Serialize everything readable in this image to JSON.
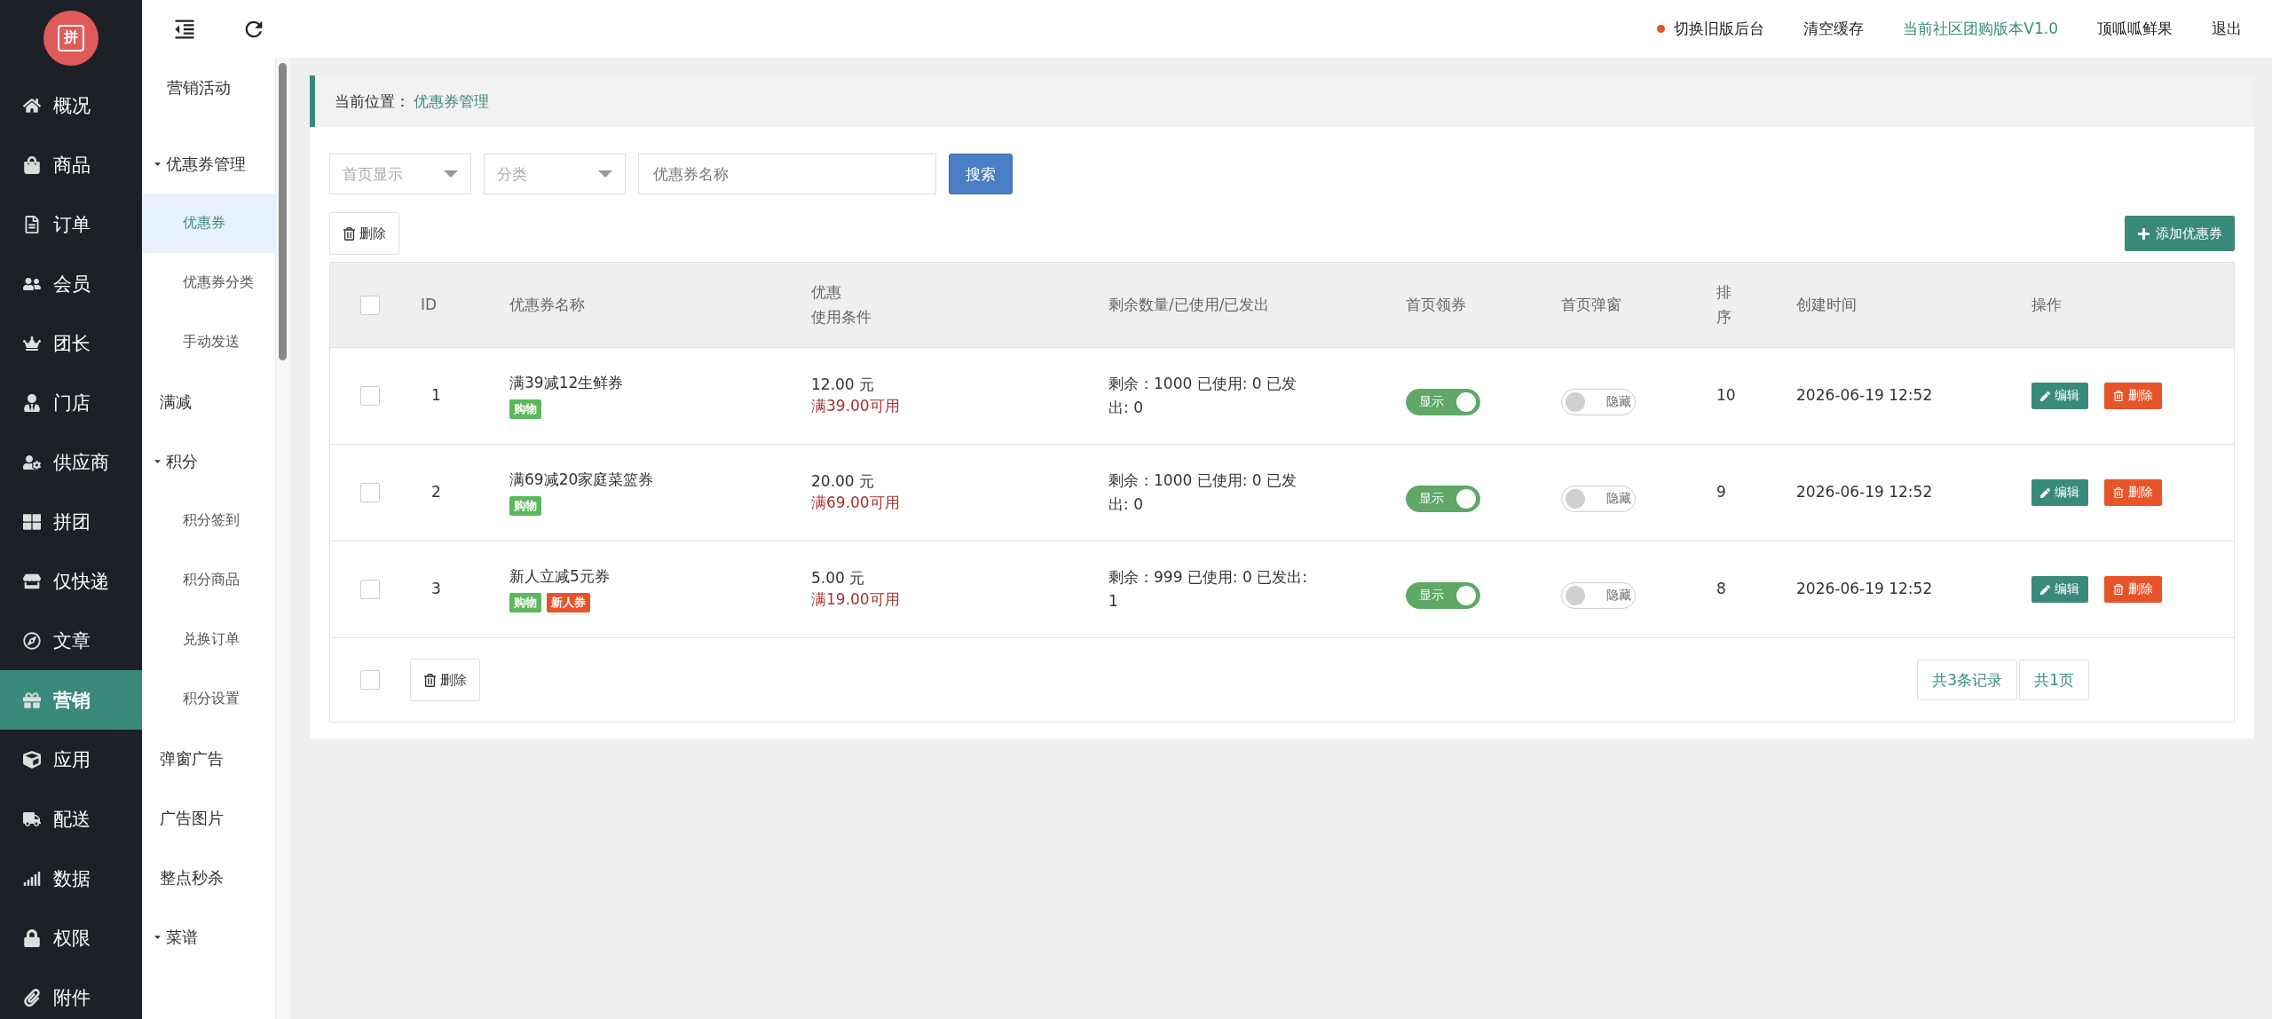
{
  "logo": {
    "text": "拼"
  },
  "nav": [
    {
      "label": "概况",
      "selected": false
    },
    {
      "label": "商品",
      "selected": false
    },
    {
      "label": "订单",
      "selected": false
    },
    {
      "label": "会员",
      "selected": false
    },
    {
      "label": "团长",
      "selected": false
    },
    {
      "label": "门店",
      "selected": false
    },
    {
      "label": "供应商",
      "selected": false
    },
    {
      "label": "拼团",
      "selected": false
    },
    {
      "label": "仅快递",
      "selected": false
    },
    {
      "label": "文章",
      "selected": false
    },
    {
      "label": "营销",
      "selected": true
    },
    {
      "label": "应用",
      "selected": false
    },
    {
      "label": "配送",
      "selected": false
    },
    {
      "label": "数据",
      "selected": false
    },
    {
      "label": "权限",
      "selected": false
    },
    {
      "label": "附件",
      "selected": false
    }
  ],
  "submenu": {
    "title": "营销活动",
    "items": [
      {
        "label": "优惠券管理",
        "expanded": true,
        "selected": false,
        "children": [
          {
            "label": "优惠券",
            "selected": true
          },
          {
            "label": "优惠券分类",
            "selected": false
          },
          {
            "label": "手动发送",
            "selected": false
          }
        ]
      },
      {
        "label": "满减",
        "selected": false
      },
      {
        "label": "积分",
        "expanded": true,
        "selected": false,
        "children": [
          {
            "label": "积分签到",
            "selected": false
          },
          {
            "label": "积分商品",
            "selected": false
          },
          {
            "label": "兑换订单",
            "selected": false
          },
          {
            "label": "积分设置",
            "selected": false
          }
        ]
      },
      {
        "label": "弹窗广告",
        "selected": false
      },
      {
        "label": "广告图片",
        "selected": false
      },
      {
        "label": "整点秒杀",
        "selected": false
      },
      {
        "label": "菜谱",
        "expanded": true,
        "selected": false
      }
    ]
  },
  "header": {
    "links": [
      {
        "label": "切换旧版后台",
        "kind": "dot"
      },
      {
        "label": "清空缓存",
        "kind": "plain"
      },
      {
        "label": "当前社区团购版本V1.0",
        "kind": "accent"
      },
      {
        "label": "顶呱呱鲜果",
        "kind": "plain"
      },
      {
        "label": "退出",
        "kind": "plain"
      }
    ]
  },
  "breadcrumb": {
    "label": "当前位置：",
    "current": "优惠券管理"
  },
  "filters": {
    "selects": [
      {
        "placeholder": "首页显示"
      },
      {
        "placeholder": "分类"
      }
    ],
    "search": {
      "placeholder": "优惠券名称"
    },
    "button": "搜索"
  },
  "toolbar": {
    "delete": "删除",
    "add": "添加优惠券"
  },
  "table": {
    "select_all": {
      "checked": false
    },
    "columns": [
      {
        "lines": [
          "ID"
        ]
      },
      {
        "lines": [
          "优惠券名称"
        ]
      },
      {
        "lines": [
          "优惠",
          "使用条件"
        ]
      },
      {
        "lines": [
          "剩余数量/已使用/已发出"
        ]
      },
      {
        "lines": [
          "首页领券"
        ]
      },
      {
        "lines": [
          "首页弹窗"
        ]
      },
      {
        "lines": [
          "排",
          "序"
        ]
      },
      {
        "lines": [
          "创建时间"
        ]
      },
      {
        "lines": [
          "操作"
        ]
      }
    ],
    "rows": [
      {
        "checked": false,
        "id": "1",
        "name": "满39减12生鲜券",
        "tags": [
          {
            "label": "购物",
            "color": "#5cb85c"
          }
        ],
        "amount": "12.00 元",
        "condition": "满39.00可用",
        "stock": "剩余：1000   已使用: 0  已发出: 0",
        "home": {
          "on": true,
          "label": "显示"
        },
        "popup": {
          "on": false,
          "label": "隐藏"
        },
        "sort": "10",
        "created": "2026-06-19 12:52",
        "edit": "编辑",
        "delete": "删除"
      },
      {
        "checked": false,
        "id": "2",
        "name": "满69减20家庭菜篮券",
        "tags": [
          {
            "label": "购物",
            "color": "#5cb85c"
          }
        ],
        "amount": "20.00 元",
        "condition": "满69.00可用",
        "stock": "剩余：1000   已使用: 0  已发出: 0",
        "home": {
          "on": true,
          "label": "显示"
        },
        "popup": {
          "on": false,
          "label": "隐藏"
        },
        "sort": "9",
        "created": "2026-06-19 12:52",
        "edit": "编辑",
        "delete": "删除"
      },
      {
        "checked": false,
        "id": "3",
        "name": "新人立减5元券",
        "tags": [
          {
            "label": "购物",
            "color": "#5cb85c"
          },
          {
            "label": "新人券",
            "color": "#e8542a"
          }
        ],
        "amount": "5.00 元",
        "condition": "满19.00可用",
        "stock": "剩余：999   已使用: 0  已发出: 1",
        "home": {
          "on": true,
          "label": "显示"
        },
        "popup": {
          "on": false,
          "label": "隐藏"
        },
        "sort": "8",
        "created": "2026-06-19 12:52",
        "edit": "编辑",
        "delete": "删除"
      }
    ],
    "footer": {
      "checked": false,
      "delete": "删除",
      "pagination": [
        "共3条记录",
        "共1页"
      ]
    }
  }
}
